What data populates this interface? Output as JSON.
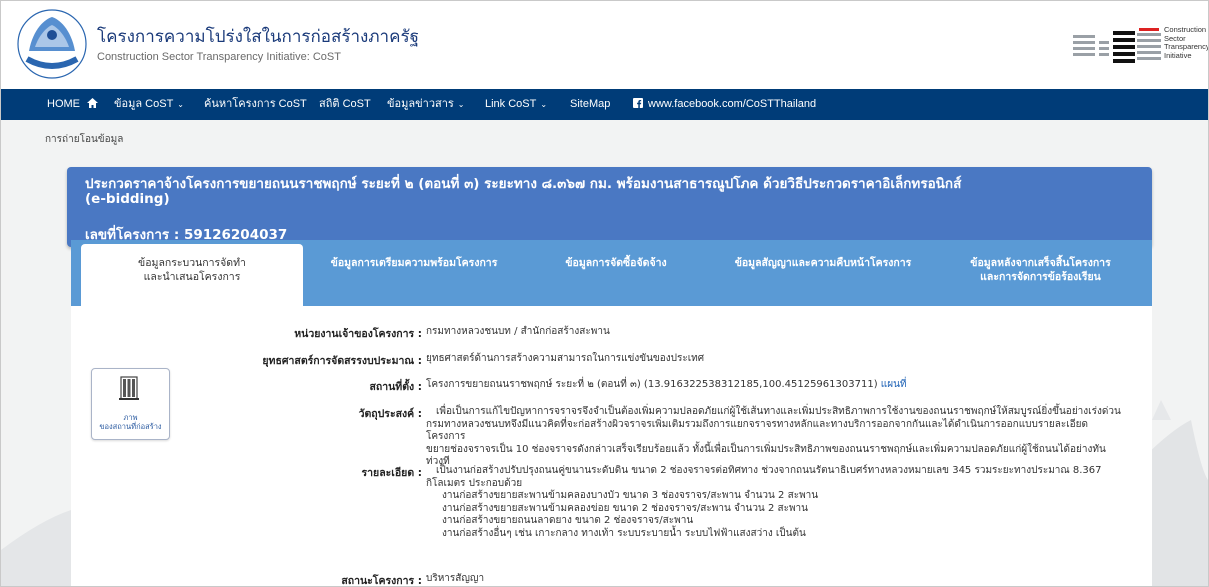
{
  "header": {
    "title": "โครงการความโปร่งใสในการก่อสร้างภาครัฐ",
    "subtitle": "Construction Sector Transparency Initiative: CoST",
    "partner_logo_text": [
      "Construction",
      "Sector",
      "Transparency",
      "Initiative"
    ]
  },
  "nav": {
    "items": [
      {
        "label": "HOME",
        "icon": "home-icon"
      },
      {
        "label": "ข้อมูล CoST",
        "dropdown": true
      },
      {
        "label": "ค้นหาโครงการ CoST"
      },
      {
        "label": "สถิติ CoST"
      },
      {
        "label": "ข้อมูลข่าวสาร",
        "dropdown": true
      },
      {
        "label": "Link CoST",
        "dropdown": true
      },
      {
        "label": "SiteMap"
      },
      {
        "label": "www.facebook.com/CoSTThailand",
        "icon": "facebook-icon"
      }
    ]
  },
  "breadcrumb": "การถ่ายโอนข้อมูล",
  "project": {
    "title": "ประกวดราคาจ้างโครงการขยายถนนราชพฤกษ์ ระยะที่ ๒ (ตอนที่ ๓) ระยะทาง ๘.๓๖๗ กม. พร้อมงานสาธารณูปโภค ด้วยวิธีประกวดราคาอิเล็กทรอนิกส์ (e-bidding)",
    "number_label": "เลขที่โครงการ : 59126204037"
  },
  "tabs": [
    {
      "label": [
        "ข้อมูลกระบวนการจัดทำ",
        "และนำเสนอโครงการ"
      ],
      "active": true
    },
    {
      "label": [
        "ข้อมูลการเตรียมความพร้อมโครงการ"
      ],
      "active": false
    },
    {
      "label": [
        "ข้อมูลการจัดซื้อจัดจ้าง"
      ],
      "active": false
    },
    {
      "label": [
        "ข้อมูลสัญญาและความคืบหน้าโครงการ"
      ],
      "active": false
    },
    {
      "label": [
        "ข้อมูลหลังจากเสร็จสิ้นโครงการ",
        "และการจัดการข้อร้องเรียน"
      ],
      "active": false
    }
  ],
  "photo": {
    "caption": [
      "ภาพ",
      "ของสถานที่ก่อสร้าง"
    ]
  },
  "details": {
    "owner_label": "หน่วยงานเจ้าของโครงการ :",
    "owner_value": "กรมทางหลวงชนบท / สำนักก่อสร้างสะพาน",
    "strategy_label": "ยุทธศาสตร์การจัดสรรงบประมาณ :",
    "strategy_value": "ยุทธศาสตร์ด้านการสร้างความสามารถในการแข่งขันของประเทศ",
    "location_label": "สถานที่ตั้ง :",
    "location_value": "โครงการขยายถนนราชพฤกษ์ ระยะที่ ๒ (ตอนที่ ๓) (13.916322538312185,100.45125961303711)",
    "map_link": "แผนที่",
    "objective_label": "วัตถุประสงค์ :",
    "objective_lines": [
      "เพื่อเป็นการแก้ไขปัญหาการจราจรจึงจำเป็นต้องเพิ่มความปลอดภัยแก่ผู้ใช้เส้นทางและเพิ่มประสิทธิภาพการใช้งานของถนนราชพฤกษ์ให้สมบูรณ์ยิ่งขึ้นอย่างเร่งด่วน",
      "กรมทางหลวงชนบทจึงมีแนวคิดที่จะก่อสร้างผิวจราจรเพิ่มเติมรวมถึงการแยกจราจรทางหลักและทางบริการออกจากกันและได้ดำเนินการออกแบบรายละเอียดโครงการ",
      "ขยายช่องจราจรเป็น 10 ช่องจราจรดังกล่าวเสร็จเรียบร้อยแล้ว ทั้งนี้เพื่อเป็นการเพิ่มประสิทธิภาพของถนนราชพฤกษ์และเพิ่มความปลอดภัยแก่ผู้ใช้ถนนได้อย่างทัน",
      "ท่วงที"
    ],
    "detail_label": "รายละเอียด :",
    "detail_lines": [
      "เป็นงานก่อสร้างปรับปรุงถนนคู่ขนานระดับดิน ขนาด 2 ช่องจราจรต่อทิศทาง ช่วงจากถนนรัตนาธิเบศร์ทางหลวงหมายเลข 345 รวมระยะทางประมาณ 8.367",
      "กิโลเมตร ประกอบด้วย",
      "งานก่อสร้างขยายสะพานข้ามคลองบางบัว ขนาด 3 ช่องจราจร/สะพาน จำนวน 2 สะพาน",
      "งานก่อสร้างขยายสะพานข้ามคลองข่อย ขนาด 2 ช่องจราจร/สะพาน จำนวน 2 สะพาน",
      "งานก่อสร้างขยายถนนลาดยาง ขนาด 2 ช่องจราจร/สะพาน",
      "งานก่อสร้างอื่นๆ เช่น เกาะกลาง ทางเท้า ระบบระบายน้ำ ระบบไฟฟ้าแสงสว่าง เป็นต้น"
    ],
    "status_label": "สถานะโครงการ :",
    "status_value": "บริหารสัญญา"
  }
}
